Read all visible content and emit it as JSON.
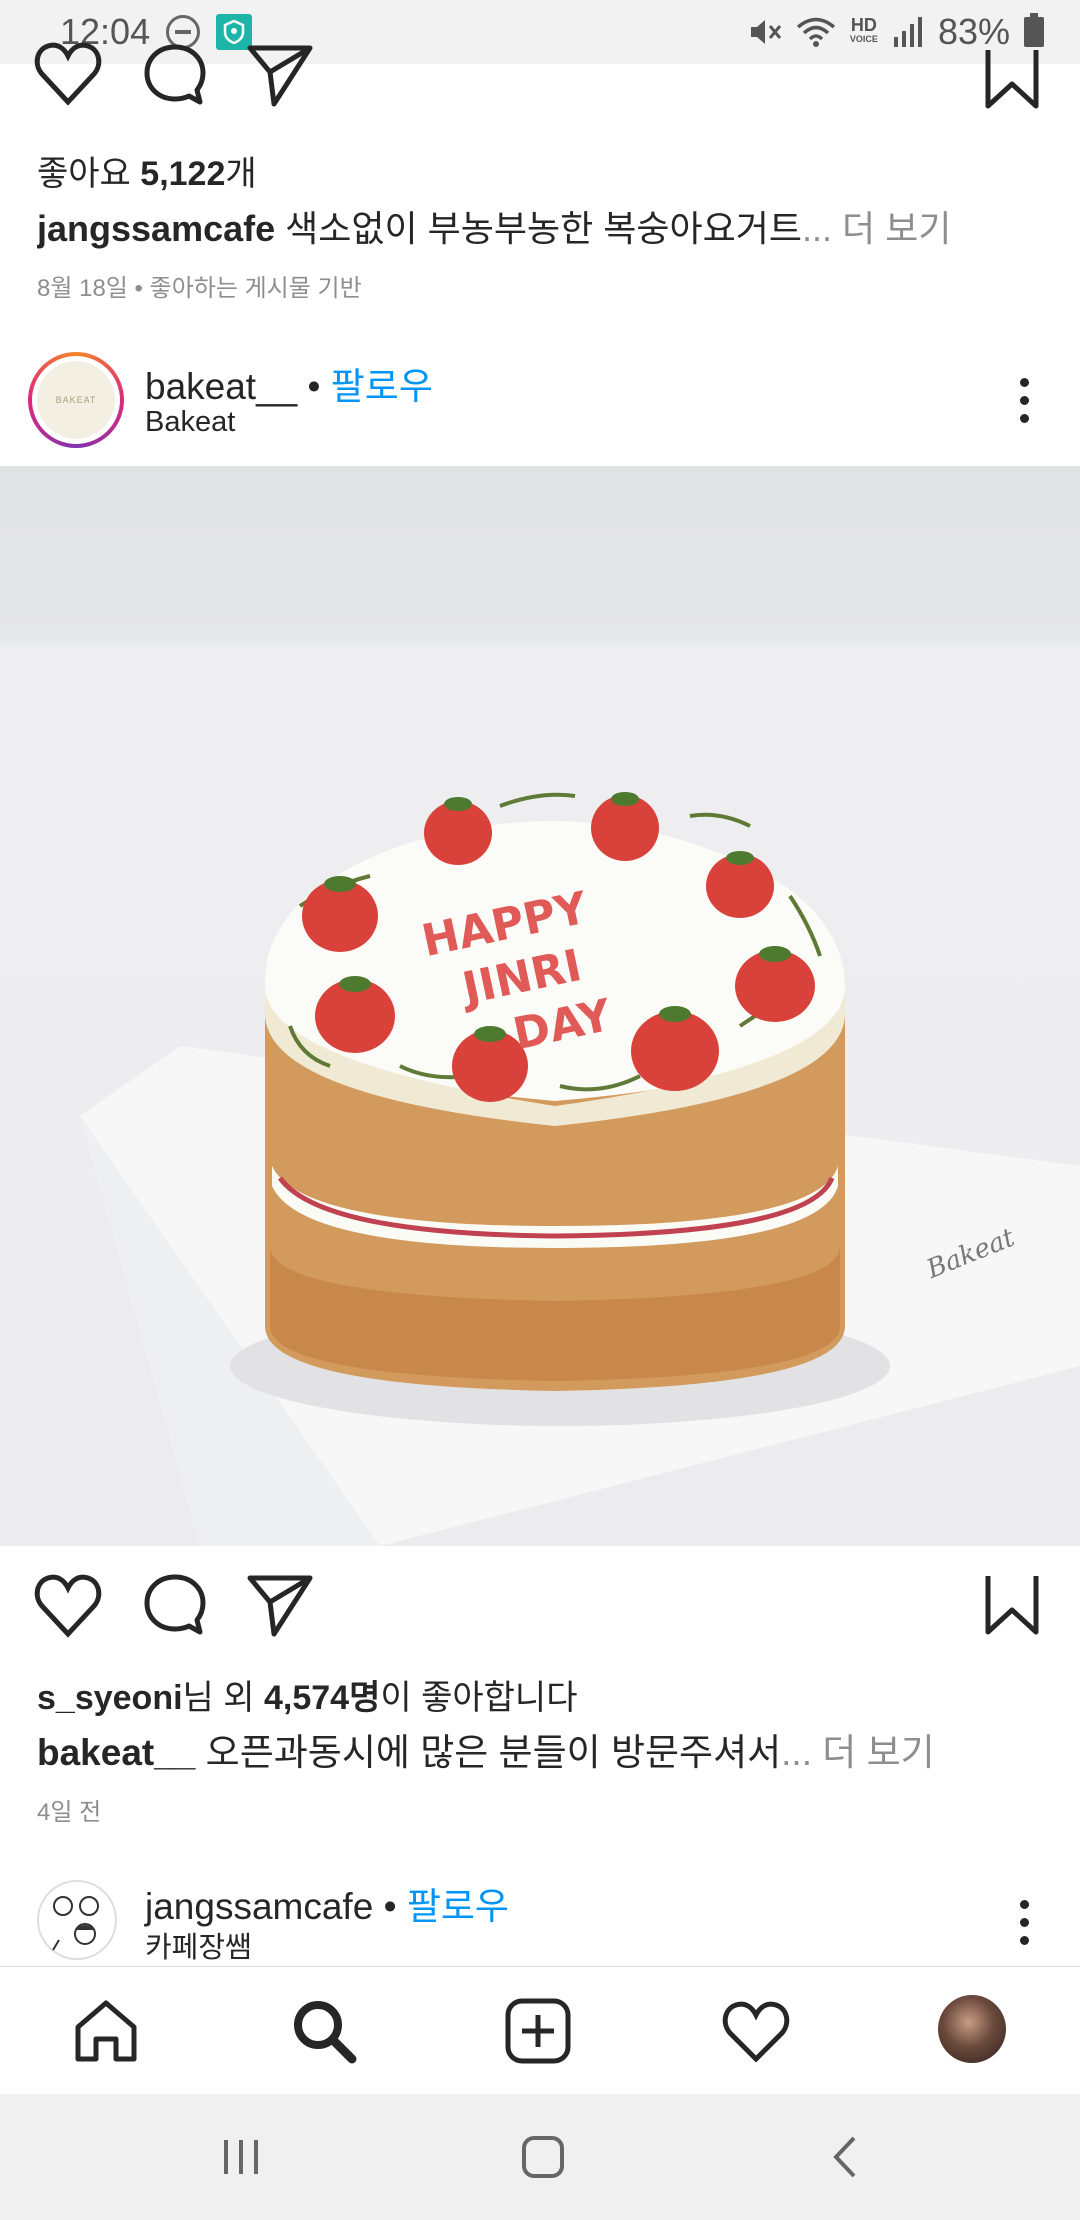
{
  "status_bar": {
    "time": "12:04",
    "hd_label_top": "HD",
    "hd_label_bottom": "VOICE",
    "battery": "83%"
  },
  "post1": {
    "likes_prefix": "좋아요 ",
    "likes_count": "5,122",
    "likes_suffix": "개",
    "caption_user": "jangssamcafe",
    "caption_text": " 색소없이 부농부농한 복숭아요거트",
    "caption_more": "... 더 보기",
    "date": "8월 18일 • 좋아하는 게시물 기반"
  },
  "post2": {
    "username": "bakeat__",
    "separator": " • ",
    "follow_label": "팔로우",
    "subname": "Bakeat",
    "avatar_logo_text": "BAKEAT",
    "photo_cake_text": [
      "HAPPY",
      "JINRI",
      "DAY"
    ],
    "photo_board_text": "Bakeat",
    "liked_by_user": "s_syeoni",
    "liked_by_mid": "님 외 ",
    "liked_by_count": "4,574명",
    "liked_by_suffix": "이 좋아합니다",
    "caption_user": "bakeat__",
    "caption_text": " 오픈과동시에 많은 분들이 방문주셔서",
    "caption_more": "... 더 보기",
    "date": "4일 전"
  },
  "post3": {
    "username": "jangssamcafe",
    "separator": " • ",
    "follow_label": "팔로우",
    "subname": "카페장쌤"
  },
  "icons": {
    "like": "heart-icon",
    "comment": "comment-icon",
    "share": "send-icon",
    "save": "bookmark-icon",
    "more": "more-vertical-icon",
    "nav_home": "home-icon",
    "nav_search": "search-icon",
    "nav_new_post": "add-post-icon",
    "nav_activity": "heart-icon",
    "nav_profile": "profile-avatar"
  },
  "colors": {
    "follow_blue": "#0095f6",
    "text": "#262626",
    "muted": "#8e8e8e",
    "story_ring_start": "#f58529",
    "story_ring_end": "#dd2a7b"
  }
}
